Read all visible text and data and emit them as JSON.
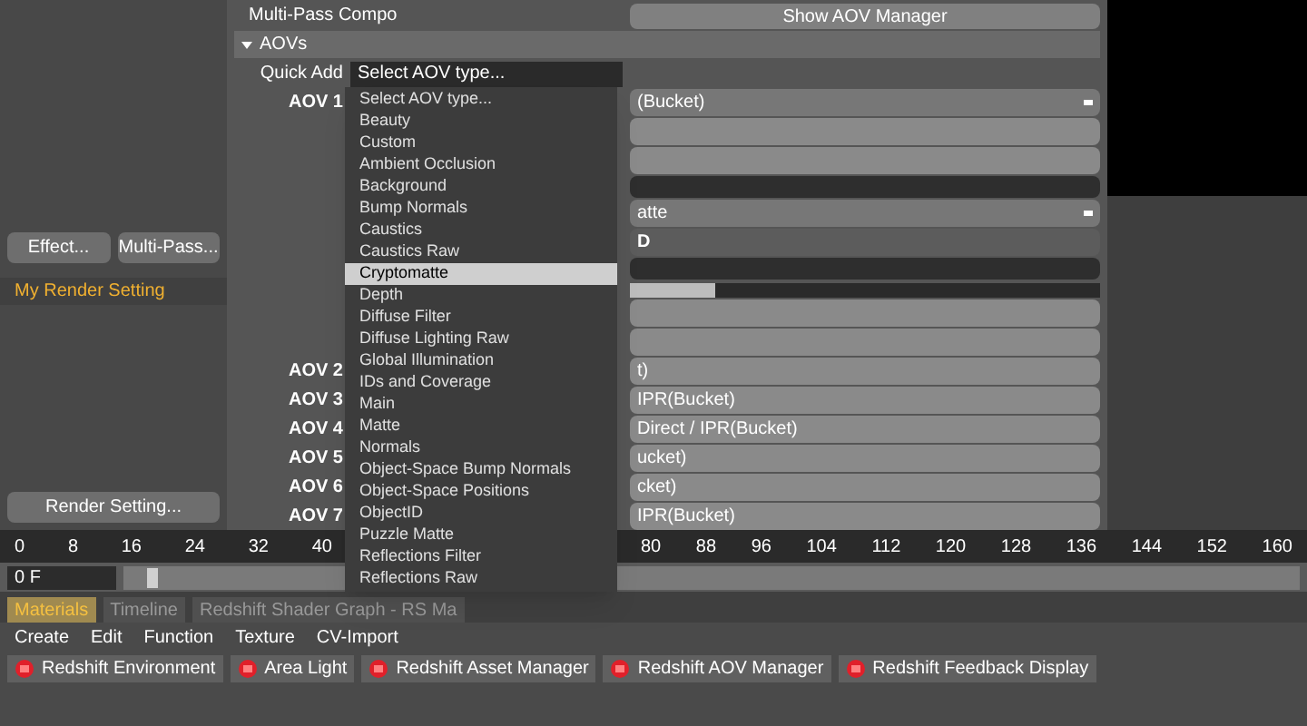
{
  "left_panel": {
    "buttons": [
      "Effect...",
      "Multi-Pass..."
    ],
    "render_settings": [
      {
        "label": "My Render Setting",
        "selected": true
      }
    ],
    "bottom_button": "Render Setting..."
  },
  "settings": {
    "title": "Multi-Pass Compo",
    "show_button": "Show AOV Manager",
    "section": {
      "label": "AOVs",
      "expanded": true
    },
    "quick_add_label": "Quick Add",
    "quick_add_value": "Select AOV type...",
    "rows": [
      {
        "label": "AOV 1",
        "kind": "dropdown",
        "value": "(Bucket)"
      },
      {
        "kind": "field"
      },
      {
        "kind": "field"
      },
      {
        "kind": "dark"
      },
      {
        "kind": "dropdown",
        "value": "atte"
      },
      {
        "kind": "darkfield",
        "value": "D"
      },
      {
        "kind": "dark"
      },
      {
        "kind": "slider",
        "level": 0.18
      },
      {
        "kind": "field"
      },
      {
        "kind": "field"
      },
      {
        "label": "AOV 2",
        "kind": "field",
        "value": "t)"
      },
      {
        "label": "AOV 3",
        "kind": "field",
        "value": "IPR(Bucket)"
      },
      {
        "label": "AOV 4",
        "kind": "field",
        "value": "Direct / IPR(Bucket)"
      },
      {
        "label": "AOV 5",
        "kind": "field",
        "value": "ucket)"
      },
      {
        "label": "AOV 6",
        "kind": "field",
        "value": "cket)"
      },
      {
        "label": "AOV 7",
        "kind": "field",
        "value": "IPR(Bucket)"
      }
    ]
  },
  "aov_menu": [
    {
      "label": "Select AOV type...",
      "selected": false
    },
    {
      "label": "Beauty",
      "selected": false
    },
    {
      "label": "Custom",
      "selected": false
    },
    {
      "label": "Ambient Occlusion",
      "selected": false
    },
    {
      "label": "Background",
      "selected": false
    },
    {
      "label": "Bump Normals",
      "selected": false
    },
    {
      "label": "Caustics",
      "selected": false
    },
    {
      "label": "Caustics Raw",
      "selected": false
    },
    {
      "label": "Cryptomatte",
      "selected": true
    },
    {
      "label": "Depth",
      "selected": false
    },
    {
      "label": "Diffuse Filter",
      "selected": false
    },
    {
      "label": "Diffuse Lighting Raw",
      "selected": false
    },
    {
      "label": "Global Illumination",
      "selected": false
    },
    {
      "label": "IDs and Coverage",
      "selected": false
    },
    {
      "label": "Main",
      "selected": false
    },
    {
      "label": "Matte",
      "selected": false
    },
    {
      "label": "Normals",
      "selected": false
    },
    {
      "label": "Object-Space Bump Normals",
      "selected": false
    },
    {
      "label": "Object-Space Positions",
      "selected": false
    },
    {
      "label": "ObjectID",
      "selected": false
    },
    {
      "label": "Puzzle Matte",
      "selected": false
    },
    {
      "label": "Reflections Filter",
      "selected": false
    },
    {
      "label": "Reflections Raw",
      "selected": false
    }
  ],
  "ruler": [
    "0",
    "8",
    "16",
    "24",
    "32",
    "40",
    "80",
    "88",
    "96",
    "104",
    "112",
    "120",
    "128",
    "136",
    "144",
    "152",
    "160"
  ],
  "frame_field": "0 F",
  "frame_slider": {
    "level": 0.02
  },
  "tabs": [
    {
      "label": "Materials",
      "selected": true
    },
    {
      "label": "Timeline",
      "selected": false
    },
    {
      "label": "Redshift Shader Graph - RS Ma",
      "selected": false
    }
  ],
  "menu": [
    "Create",
    "Edit",
    "Function",
    "Texture",
    "CV-Import"
  ],
  "toolbar": [
    {
      "label": "Redshift Environment"
    },
    {
      "label": "Area Light"
    },
    {
      "label": "Redshift Asset Manager"
    },
    {
      "label": "Redshift AOV Manager"
    },
    {
      "label": "Redshift Feedback Display"
    }
  ]
}
